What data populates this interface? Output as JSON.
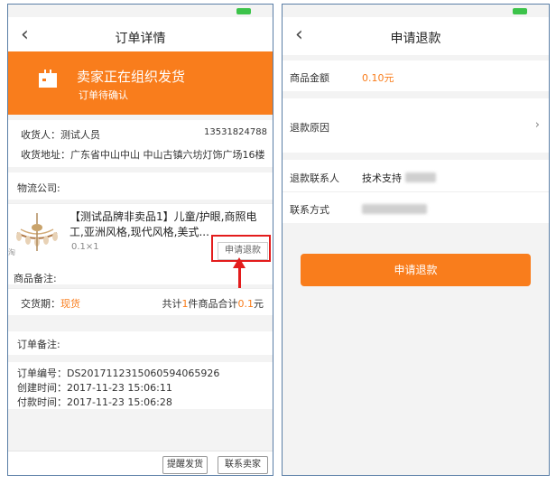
{
  "left": {
    "nav": {
      "back_icon": "chevron-left-icon",
      "title": "订单详情"
    },
    "banner": {
      "title": "卖家正在组织发货",
      "subtitle": "订单待确认"
    },
    "address": {
      "recipient": "收货人：测试人员",
      "phone": "13531824788",
      "address": "收货地址：广东省中山中山 中山古镇六坊灯饰广场16楼"
    },
    "logistics_label": "物流公司:",
    "product": {
      "title": "【测试品牌非卖品1】儿童/护眼,商照电工,亚洲风格,现代风格,美式...",
      "price_qty": "0.1×1",
      "refund_button": "申请退款",
      "remark_label": "商品备注:",
      "tao_mark": "淘"
    },
    "delivery": {
      "label": "交货期：",
      "value": "现货",
      "total_prefix": "共计",
      "count": "1",
      "total_mid": "件商品合计",
      "amount": "0.1",
      "unit": "元"
    },
    "order_remark_label": "订单备注:",
    "order_info": {
      "order_no": "订单编号：DS20171123150605940659​26",
      "created": "创建时间：2017-11-23 15:06:11",
      "paid": "付款时间：2017-11-23 15:06:28"
    },
    "footer": {
      "remind": "提醒发货",
      "contact": "联系卖家"
    }
  },
  "right": {
    "nav": {
      "back_icon": "chevron-left-icon",
      "title": "申请退款"
    },
    "amount_label": "商品金额",
    "amount_value": "0.10元",
    "reason_label": "退款原因",
    "contact_person_label": "退款联系人",
    "contact_person_value": "技术支持",
    "contact_method_label": "联系方式",
    "apply_button": "申请退款"
  },
  "colors": {
    "accent": "#f97d1c",
    "highlight": "#e31c1c",
    "battery": "#3cc34a"
  }
}
